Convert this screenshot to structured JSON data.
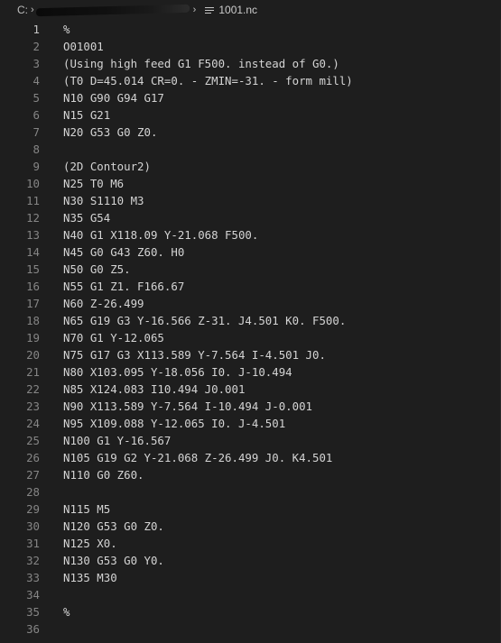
{
  "breadcrumb": {
    "root": "C:",
    "chevron": "›",
    "file_icon": "file-lines-icon",
    "file_name": "1001.nc"
  },
  "editor": {
    "active_line": 1,
    "lines": [
      {
        "n": "1",
        "text": "%"
      },
      {
        "n": "2",
        "text": "O01001"
      },
      {
        "n": "3",
        "text": "(Using high feed G1 F500. instead of G0.)"
      },
      {
        "n": "4",
        "text": "(T0 D=45.014 CR=0. - ZMIN=-31. - form mill)"
      },
      {
        "n": "5",
        "text": "N10 G90 G94 G17"
      },
      {
        "n": "6",
        "text": "N15 G21"
      },
      {
        "n": "7",
        "text": "N20 G53 G0 Z0."
      },
      {
        "n": "8",
        "text": ""
      },
      {
        "n": "9",
        "text": "(2D Contour2)"
      },
      {
        "n": "10",
        "text": "N25 T0 M6"
      },
      {
        "n": "11",
        "text": "N30 S1110 M3"
      },
      {
        "n": "12",
        "text": "N35 G54"
      },
      {
        "n": "13",
        "text": "N40 G1 X118.09 Y-21.068 F500."
      },
      {
        "n": "14",
        "text": "N45 G0 G43 Z60. H0"
      },
      {
        "n": "15",
        "text": "N50 G0 Z5."
      },
      {
        "n": "16",
        "text": "N55 G1 Z1. F166.67"
      },
      {
        "n": "17",
        "text": "N60 Z-26.499"
      },
      {
        "n": "18",
        "text": "N65 G19 G3 Y-16.566 Z-31. J4.501 K0. F500."
      },
      {
        "n": "19",
        "text": "N70 G1 Y-12.065"
      },
      {
        "n": "20",
        "text": "N75 G17 G3 X113.589 Y-7.564 I-4.501 J0."
      },
      {
        "n": "21",
        "text": "N80 X103.095 Y-18.056 I0. J-10.494"
      },
      {
        "n": "22",
        "text": "N85 X124.083 I10.494 J0.001"
      },
      {
        "n": "23",
        "text": "N90 X113.589 Y-7.564 I-10.494 J-0.001"
      },
      {
        "n": "24",
        "text": "N95 X109.088 Y-12.065 I0. J-4.501"
      },
      {
        "n": "25",
        "text": "N100 G1 Y-16.567"
      },
      {
        "n": "26",
        "text": "N105 G19 G2 Y-21.068 Z-26.499 J0. K4.501"
      },
      {
        "n": "27",
        "text": "N110 G0 Z60."
      },
      {
        "n": "28",
        "text": ""
      },
      {
        "n": "29",
        "text": "N115 M5"
      },
      {
        "n": "30",
        "text": "N120 G53 G0 Z0."
      },
      {
        "n": "31",
        "text": "N125 X0."
      },
      {
        "n": "32",
        "text": "N130 G53 G0 Y0."
      },
      {
        "n": "33",
        "text": "N135 M30"
      },
      {
        "n": "34",
        "text": ""
      },
      {
        "n": "35",
        "text": "%"
      },
      {
        "n": "36",
        "text": ""
      }
    ]
  },
  "colors": {
    "background": "#1e1e1e",
    "text": "#d4d4d4",
    "line_number": "#858585",
    "line_number_active": "#c6c6c6"
  }
}
